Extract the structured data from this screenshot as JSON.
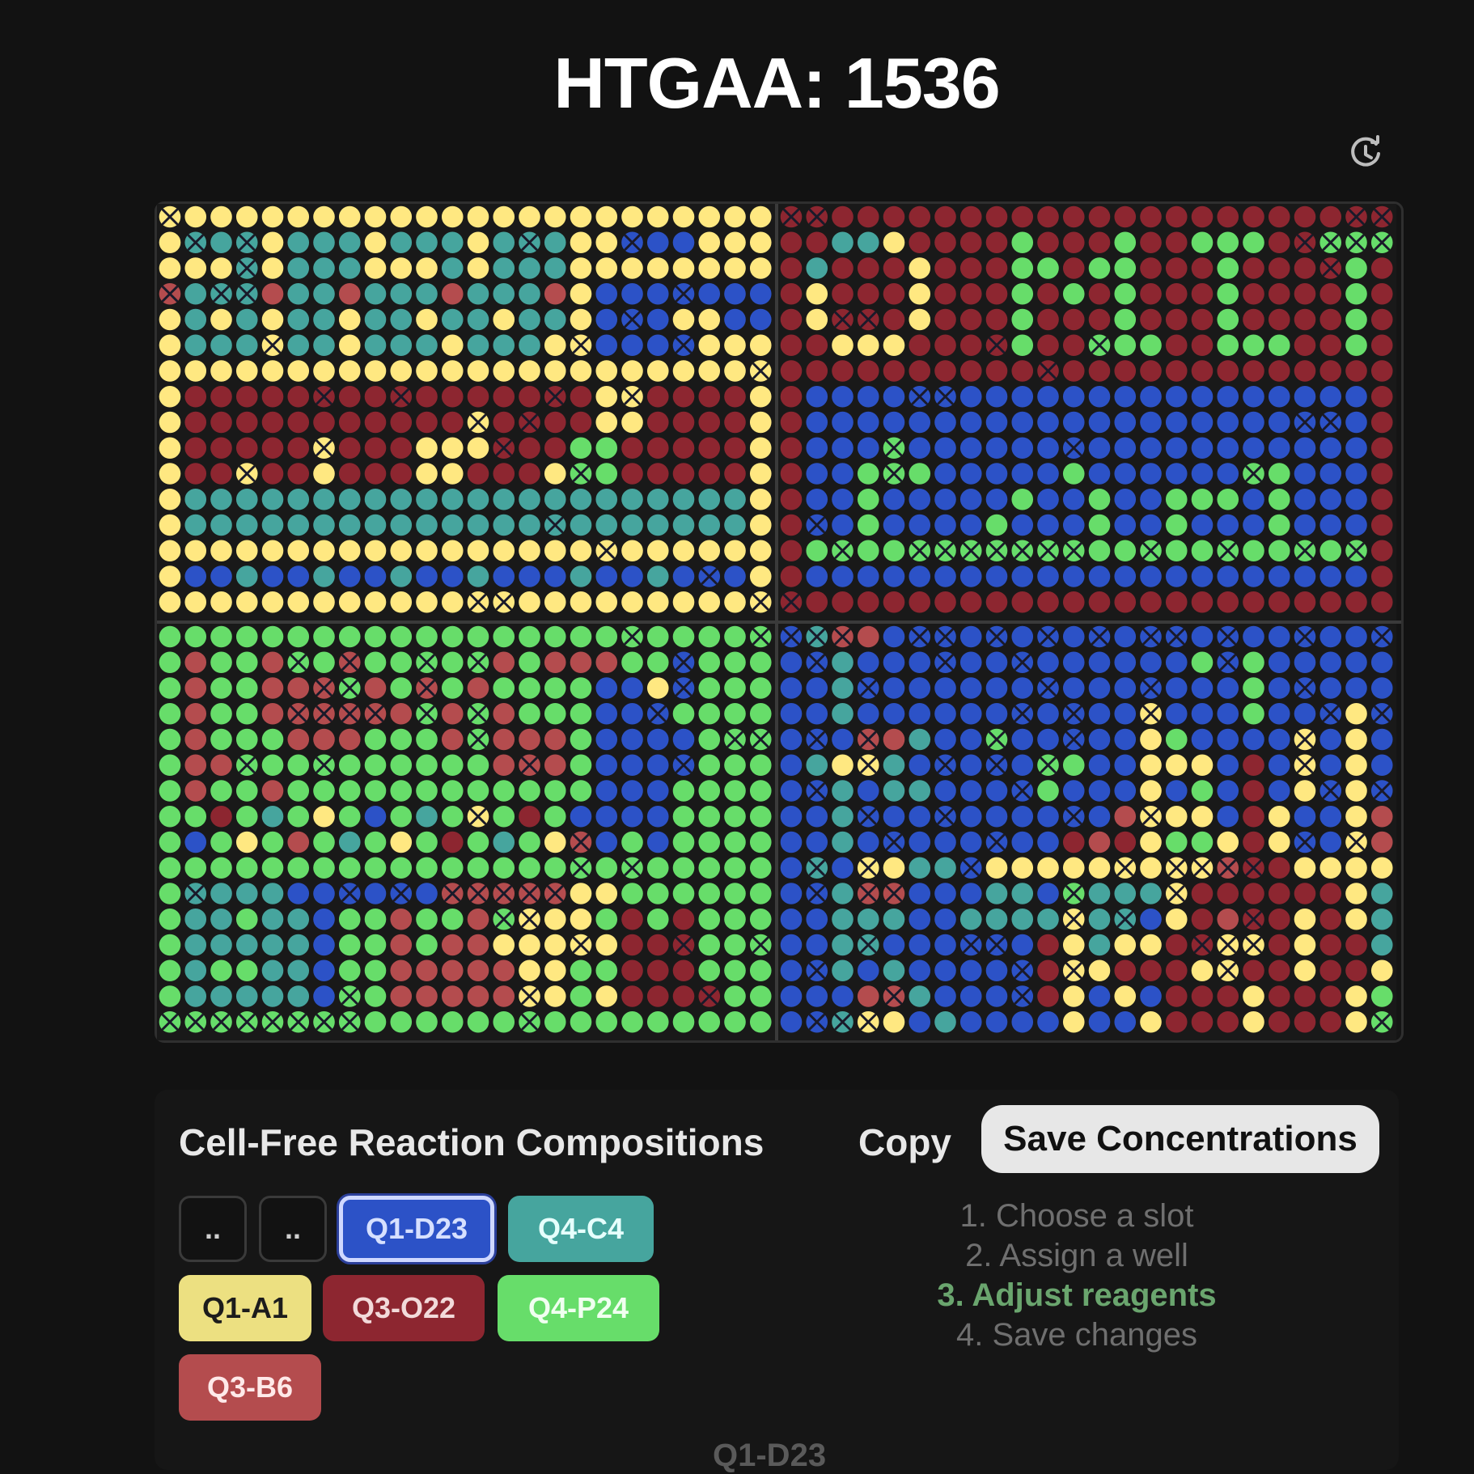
{
  "header": {
    "title": "HTGAA: 1536",
    "history_icon": "history-clock-icon"
  },
  "palette": {
    "Y": "#ffe881",
    "T": "#46a59e",
    "B": "#2c52c7",
    "D": "#8d2630",
    "R": "#b44c4e",
    "G": "#67dd6a",
    "X": "#2a2a2a"
  },
  "plate": {
    "quadrants": [
      {
        "id": "Q1",
        "rows": [
          "YYYYYYYYYYYYYYYYYYYYYYYY",
          "YTTTYTTTYTTTYTTTYYBBBYYY",
          "YYYTYTTTYYYTYTTTYYYYYYYY",
          "RTTTRTTRTTTRTTTRYBBBBBBB",
          "YTYTYTTYTTYTTYTTYBBBYYBB",
          "YTTTYTTYTTTYTTTYYBBBBYYY",
          "YYYYYYYYYYYYYYYYYYYYYYYY",
          "YDDDDDDDDDDDDDDDDYYDDDDY",
          "YDDDDDDDDDDDYDDDDYYDDDDY",
          "YDDDDDYDDDYYYDDDGGDDDDDY",
          "YDDYDDYDDDYYDDDYGGDDDDDY",
          "YTTTTTTTTTTTTTTTTTTTTTTY",
          "YTTTTTTTTTTTTTTTTTTTTTTY",
          "YYYYYYYYYYYYYYYYYYYYYYYY",
          "YBBTBBTBBTBBTBBBTBBTBBBY",
          "YYYYYYYYYYYYYYYYYYYYYYYY"
        ],
        "crossed": [
          [
            0,
            0
          ],
          [
            1,
            1
          ],
          [
            1,
            3
          ],
          [
            1,
            14
          ],
          [
            1,
            18
          ],
          [
            2,
            3
          ],
          [
            3,
            0
          ],
          [
            3,
            2
          ],
          [
            3,
            3
          ],
          [
            3,
            20
          ],
          [
            4,
            18
          ],
          [
            5,
            4
          ],
          [
            5,
            16
          ],
          [
            5,
            20
          ],
          [
            6,
            23
          ],
          [
            7,
            6
          ],
          [
            7,
            9
          ],
          [
            7,
            15
          ],
          [
            7,
            18
          ],
          [
            8,
            12
          ],
          [
            8,
            14
          ],
          [
            9,
            6
          ],
          [
            9,
            13
          ],
          [
            10,
            3
          ],
          [
            10,
            16
          ],
          [
            12,
            15
          ],
          [
            13,
            17
          ],
          [
            14,
            21
          ],
          [
            15,
            12
          ],
          [
            15,
            13
          ],
          [
            15,
            23
          ]
        ]
      },
      {
        "id": "Q2",
        "rows": [
          "DDDDDDDDDDDDDDDDDDDDDDDD",
          "DDTTYDDDDGDDDGDDGGGDDGGG",
          "DTDDDYDDDGGDGGDDDGDDDDGD",
          "DYDDDYDDDGDGDGDDDGDDDDGD",
          "DYDDDYDDDGDDDGDDDGDDDDGD",
          "DDYYYDDDDGDDGGGDDGGGDDGD",
          "DDDDDDDDDDDDDDDDDDDDDDDD",
          "DBBBBBBBBBBBBBBBBBBBBBBD",
          "DBBBBBBBBBBBBBBBBBBBBBBD",
          "DBBBGBBBBBBBBBBBBBBBBBBD",
          "DBBGGGBBBBBGBBBBBBGGBBBD",
          "DBBGBBBBBGBBGBBGGGBGBBBD",
          "DBBGBBBBGBBBGBBGBBBGBBBD",
          "DGGGGGGGGGGGGGGGGGGGGGGD",
          "DBBBBBBBBBBBBBBBBBBBBBBD",
          "DDDDDDDDDDDDDDDDDDDDDDDD"
        ],
        "crossed": [
          [
            0,
            0
          ],
          [
            0,
            1
          ],
          [
            0,
            22
          ],
          [
            0,
            23
          ],
          [
            1,
            20
          ],
          [
            1,
            21
          ],
          [
            1,
            22
          ],
          [
            1,
            23
          ],
          [
            2,
            21
          ],
          [
            4,
            2
          ],
          [
            4,
            3
          ],
          [
            5,
            8
          ],
          [
            5,
            12
          ],
          [
            6,
            10
          ],
          [
            7,
            5
          ],
          [
            7,
            6
          ],
          [
            8,
            20
          ],
          [
            8,
            21
          ],
          [
            9,
            4
          ],
          [
            9,
            11
          ],
          [
            10,
            4
          ],
          [
            10,
            18
          ],
          [
            12,
            1
          ],
          [
            13,
            2
          ],
          [
            13,
            5
          ],
          [
            13,
            6
          ],
          [
            13,
            7
          ],
          [
            13,
            8
          ],
          [
            13,
            9
          ],
          [
            13,
            10
          ],
          [
            13,
            11
          ],
          [
            13,
            14
          ],
          [
            13,
            17
          ],
          [
            13,
            20
          ],
          [
            13,
            22
          ],
          [
            15,
            0
          ]
        ]
      },
      {
        "id": "Q3",
        "rows": [
          "GGGGGGGGGGGGGGGGGGGGGGGG",
          "GRGGRGGRGGGGGRGRRRGGBGGG",
          "GRGGRRRGRGRGRGGGGBBYBGGG",
          "GRGGRRRRRRGRGRGGGBBBGGGG",
          "GRGGGRRRGGGRGRRRGBBBBGGG",
          "GRRGGGGGGGGGGRRRGBBBBGGG",
          "GRGGRGGGGGGGGGGGGBBBGGGG",
          "GGDGTGYGBGTGYGDGBBBBGGGG",
          "GBGYGRGTGYGDGTGYRBGBGGGG",
          "GGGGGGGGGGGGGGGGGGGGGGGG",
          "GTTTTBBBBBBRRRRRYYGGGGGG",
          "GTTGTTBGGRGGRGYYYGDGDGGG",
          "GTTTTTBGGRGRRYYYYYDDDGGG",
          "GTGGTTBGGRRRRRYYGGDDDGGG",
          "GTTTTTBGGRRRRRYYGYDDDDGG",
          "GGGGGGGGGGGGGGGGGGGGGGGG"
        ],
        "crossed": [
          [
            0,
            18
          ],
          [
            0,
            23
          ],
          [
            1,
            5
          ],
          [
            1,
            7
          ],
          [
            1,
            10
          ],
          [
            1,
            12
          ],
          [
            1,
            20
          ],
          [
            2,
            20
          ],
          [
            2,
            6
          ],
          [
            2,
            7
          ],
          [
            2,
            10
          ],
          [
            3,
            5
          ],
          [
            3,
            6
          ],
          [
            3,
            7
          ],
          [
            3,
            8
          ],
          [
            3,
            10
          ],
          [
            3,
            12
          ],
          [
            3,
            19
          ],
          [
            4,
            12
          ],
          [
            4,
            22
          ],
          [
            4,
            23
          ],
          [
            5,
            3
          ],
          [
            5,
            6
          ],
          [
            5,
            14
          ],
          [
            5,
            20
          ],
          [
            7,
            12
          ],
          [
            8,
            16
          ],
          [
            9,
            16
          ],
          [
            9,
            18
          ],
          [
            10,
            1
          ],
          [
            10,
            7
          ],
          [
            10,
            9
          ],
          [
            10,
            11
          ],
          [
            10,
            12
          ],
          [
            10,
            13
          ],
          [
            10,
            14
          ],
          [
            10,
            15
          ],
          [
            11,
            13
          ],
          [
            11,
            14
          ],
          [
            12,
            16
          ],
          [
            12,
            20
          ],
          [
            12,
            23
          ],
          [
            14,
            7
          ],
          [
            14,
            14
          ],
          [
            14,
            21
          ],
          [
            15,
            0
          ],
          [
            15,
            1
          ],
          [
            15,
            2
          ],
          [
            15,
            3
          ],
          [
            15,
            4
          ],
          [
            15,
            5
          ],
          [
            15,
            6
          ],
          [
            15,
            7
          ],
          [
            15,
            14
          ]
        ]
      },
      {
        "id": "Q4",
        "rows": [
          "BTRRBBBBBBBBBBBBBBBBBBBB",
          "BBTBBBBBBBBBBBBBGBGBBBBB",
          "BBTBBBBBBBBBBBBBBBGBBBBB",
          "BBTBBBBBBBBBBBYBBBGBBBYB",
          "BBBRRTBBGBBBBBYGBBBBYBYB",
          "BTYYTBBBBBGGBBYYYBDBYBYB",
          "BBTBTTBBBBGBBBYBGBDBYBYB",
          "BBTBBBBBBBBBBRYYYBDYBBYR",
          "BBTBBBBBBBBDRDYGGYDYBBYR",
          "BTBYYTTBYYYYYYYYYRDDYYYY",
          "BBTRRBBBTTBGTTTYDDDDDDYT",
          "BBTTTBBTTTTYTTBYDRDDYDYT",
          "BBTTBBBBBBDYTYYDDYYDYDDT",
          "BBTBTBBBBBDYYDDDYYDDYDDY",
          "BBBRRTBBBBDYBYBDDDYDDDYG",
          "BBTYYBTBBBBYBBYDDDYDDDYG"
        ],
        "crossed": [
          [
            0,
            0
          ],
          [
            0,
            1
          ],
          [
            0,
            2
          ],
          [
            0,
            5
          ],
          [
            0,
            6
          ],
          [
            0,
            8
          ],
          [
            0,
            10
          ],
          [
            0,
            12
          ],
          [
            0,
            14
          ],
          [
            0,
            15
          ],
          [
            0,
            17
          ],
          [
            0,
            20
          ],
          [
            0,
            23
          ],
          [
            1,
            1
          ],
          [
            1,
            6
          ],
          [
            1,
            9
          ],
          [
            1,
            17
          ],
          [
            2,
            3
          ],
          [
            2,
            10
          ],
          [
            2,
            14
          ],
          [
            2,
            20
          ],
          [
            3,
            9
          ],
          [
            3,
            11
          ],
          [
            3,
            14
          ],
          [
            3,
            21
          ],
          [
            3,
            23
          ],
          [
            4,
            1
          ],
          [
            4,
            3
          ],
          [
            4,
            8
          ],
          [
            4,
            11
          ],
          [
            4,
            20
          ],
          [
            5,
            3
          ],
          [
            5,
            6
          ],
          [
            5,
            8
          ],
          [
            5,
            10
          ],
          [
            5,
            20
          ],
          [
            6,
            1
          ],
          [
            6,
            9
          ],
          [
            6,
            21
          ],
          [
            6,
            23
          ],
          [
            7,
            3
          ],
          [
            7,
            6
          ],
          [
            7,
            11
          ],
          [
            7,
            14
          ],
          [
            8,
            4
          ],
          [
            8,
            8
          ],
          [
            8,
            20
          ],
          [
            8,
            22
          ],
          [
            9,
            1
          ],
          [
            9,
            3
          ],
          [
            9,
            7
          ],
          [
            9,
            13
          ],
          [
            9,
            15
          ],
          [
            9,
            16
          ],
          [
            9,
            17
          ],
          [
            9,
            18
          ],
          [
            10,
            1
          ],
          [
            10,
            3
          ],
          [
            10,
            4
          ],
          [
            10,
            11
          ],
          [
            10,
            15
          ],
          [
            11,
            11
          ],
          [
            11,
            13
          ],
          [
            11,
            18
          ],
          [
            12,
            3
          ],
          [
            12,
            7
          ],
          [
            12,
            8
          ],
          [
            12,
            16
          ],
          [
            12,
            17
          ],
          [
            12,
            18
          ],
          [
            13,
            1
          ],
          [
            13,
            9
          ],
          [
            13,
            11
          ],
          [
            13,
            17
          ],
          [
            14,
            4
          ],
          [
            14,
            9
          ],
          [
            15,
            1
          ],
          [
            15,
            2
          ],
          [
            15,
            3
          ],
          [
            15,
            23
          ]
        ]
      }
    ]
  },
  "compositions": {
    "title": "Cell-Free Reaction Compositions",
    "copy_label": "Copy",
    "save_label": "Save Concentrations",
    "chips": [
      {
        "label": "..",
        "style": "empty"
      },
      {
        "label": "..",
        "style": "empty"
      },
      {
        "label": "Q1-D23",
        "color": "#2c52c7",
        "text_color": "#d6e0ff",
        "selected": true
      },
      {
        "label": "Q4-C4",
        "color": "#46a59e",
        "text_color": "#e6fffc"
      },
      {
        "label": "Q1-A1",
        "color": "#ece081",
        "text_color": "#1c1c1c"
      },
      {
        "label": "Q3-O22",
        "color": "#8d2630",
        "text_color": "#f2dada"
      },
      {
        "label": "Q4-P24",
        "color": "#67dd6a",
        "text_color": "#f0fff0"
      },
      {
        "label": "Q3-B6",
        "color": "#b44c4e",
        "text_color": "#ffe9e9"
      }
    ],
    "steps": [
      "1. Choose a slot",
      "2. Assign a well",
      "3. Adjust reagents",
      "4. Save changes"
    ],
    "active_step": 2,
    "partial_label": "Q1-D23"
  }
}
